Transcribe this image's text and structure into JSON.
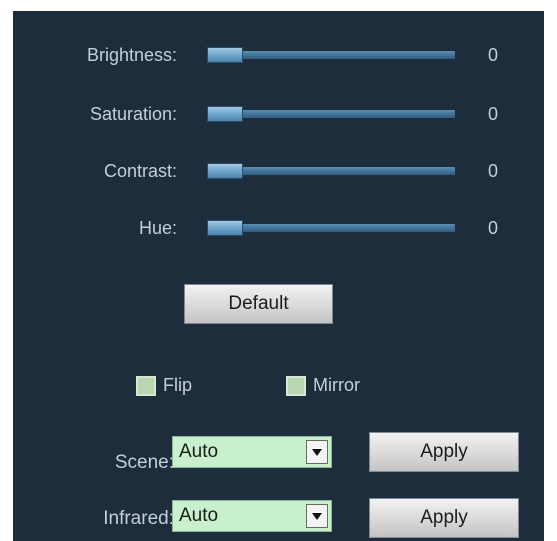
{
  "sliders": [
    {
      "label": "Brightness:",
      "value": "0",
      "level": 0
    },
    {
      "label": "Saturation:",
      "value": "0",
      "level": 0
    },
    {
      "label": "Contrast:",
      "value": "0",
      "level": 0
    },
    {
      "label": "Hue:",
      "value": "0",
      "level": 0
    }
  ],
  "default_button": "Default",
  "checkboxes": [
    {
      "label": "Flip",
      "checked": false
    },
    {
      "label": "Mirror",
      "checked": false
    }
  ],
  "selects": [
    {
      "label": "Scene:",
      "value": "Auto",
      "apply_label": "Apply"
    },
    {
      "label": "Infrared:",
      "value": "Auto",
      "apply_label": "Apply"
    }
  ],
  "colors": {
    "panel_background": "#1e2d3b",
    "select_background": "#c8f0cc",
    "checkbox_fill": "#b9d7b0"
  }
}
